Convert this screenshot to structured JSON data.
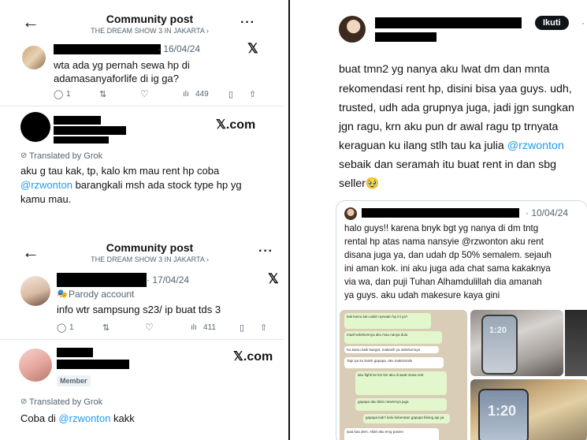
{
  "post1": {
    "header_title": "Community post",
    "header_subtitle": "THE DREAM SHOW 3 IN JAKARTA ›",
    "date": "· 16/04/24",
    "text": "wta ada yg pernah sewa hp di adamasanyaforlife di ig ga?",
    "replies": "1",
    "views": "449"
  },
  "reply1": {
    "x_label": "𝕏.com",
    "translated": "Translated by Grok",
    "text_a": "aku g tau kak, tp, kalo km mau rent hp coba",
    "mention": "@rzwonton",
    "text_b": " barangkali msh ada stock type hp yg",
    "text_c": "kamu mau."
  },
  "post2": {
    "header_title": "Community post",
    "header_subtitle": "THE DREAM SHOW 3 IN JAKARTA ›",
    "date": "· 17/04/24",
    "parody": "Parody account",
    "text": "info wtr sampsung s23/ ip buat tds 3",
    "replies": "1",
    "views": "411"
  },
  "reply2": {
    "x_label": "𝕏.com",
    "badge": "Member",
    "translated": "Translated by Grok",
    "text_a": "Coba di ",
    "mention": "@rzwonton",
    "text_b": " kakk"
  },
  "right_post": {
    "follow_label": "Ikuti",
    "lines": [
      "buat tmn2 yg nanya aku lwat dm dan mnta",
      "rekomendasi rent hp, disini bisa yaa guys. udh,",
      "trusted, udh ada grupnya juga, jadi jgn sungkan",
      "jgn ragu, krn aku pun dr awal ragu tp trnyata",
      "keraguan ku ilang stlh tau ka julia "
    ],
    "mention": "@rzwonton",
    "line6": "sebaik dan seramah itu buat rent in dan sbg",
    "line7": "seller🥹"
  },
  "quoted": {
    "date": "· 10/04/24",
    "lines": [
      "halo guys!! karena bnyk bgt yg nanya di dm tntg",
      "rental hp atas nama nansyie @rzwonton aku rent",
      "disana juga ya, dan udah dp 50% semalem. sejauh",
      "ini aman kok. ini aku juga ada chat sama kakaknya",
      "via wa, dan puji Tuhan Alhamdulillah dia amanah",
      "ya guys. aku udah makesure kaya gini"
    ],
    "chat": [
      "kak kamu kan udah nyewain hp ini ya?",
      "maaf sebelumnya aku mau nanya dulu",
      "Ka kamu baik banget, makasih ya sebelumnya",
      "Tapi iya ko boleh gapapa, aku maksimalin",
      "aku fighti ke km km aku di awal masa rent",
      "gapapa aku bikin newernya juga",
      "gapapa kak? kalo keberatan gapapa bilang aja ya",
      "iyaa kaa dem. Allah aku emg pasien"
    ],
    "phone_time": "1:20"
  },
  "colors": {
    "link": "#1d9bf0",
    "muted": "#536471",
    "chat_green": "#e2f7cb",
    "chat_bg": "#d9cdb8"
  }
}
